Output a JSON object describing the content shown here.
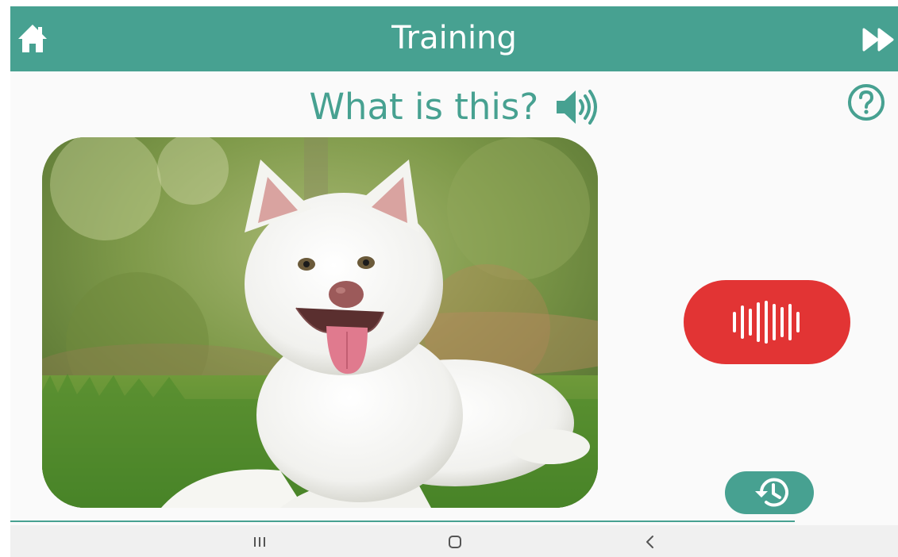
{
  "header": {
    "title": "Training",
    "home_icon": "home-icon",
    "skip_icon": "fast-forward-icon"
  },
  "question": {
    "text": "What is this?",
    "speaker_icon": "speaker-icon",
    "help_icon": "help-circle-icon"
  },
  "photo": {
    "subject": "dog"
  },
  "controls": {
    "record_icon": "voice-waveform-icon",
    "history_icon": "history-icon"
  },
  "navbar": {
    "recents_icon": "recent-apps-icon",
    "home_icon": "nav-home-icon",
    "back_icon": "back-icon"
  },
  "colors": {
    "accent": "#47a191",
    "record": "#e23434",
    "background": "#fafafa",
    "navbar": "#f0f0f0"
  }
}
